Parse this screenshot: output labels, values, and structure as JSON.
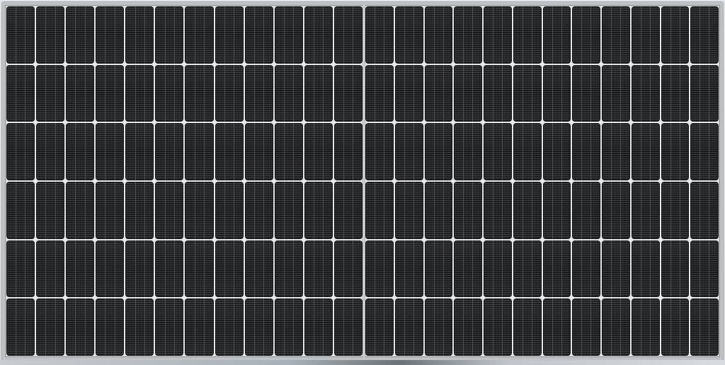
{
  "scene": {
    "subject": "solar-panel",
    "colors": {
      "cell": "#1c1d1f",
      "frame": "#bfc3c6",
      "gap": "#e6e8ea"
    }
  },
  "panel": {
    "halves": 2,
    "rows": 6,
    "columns_per_half": 12
  }
}
